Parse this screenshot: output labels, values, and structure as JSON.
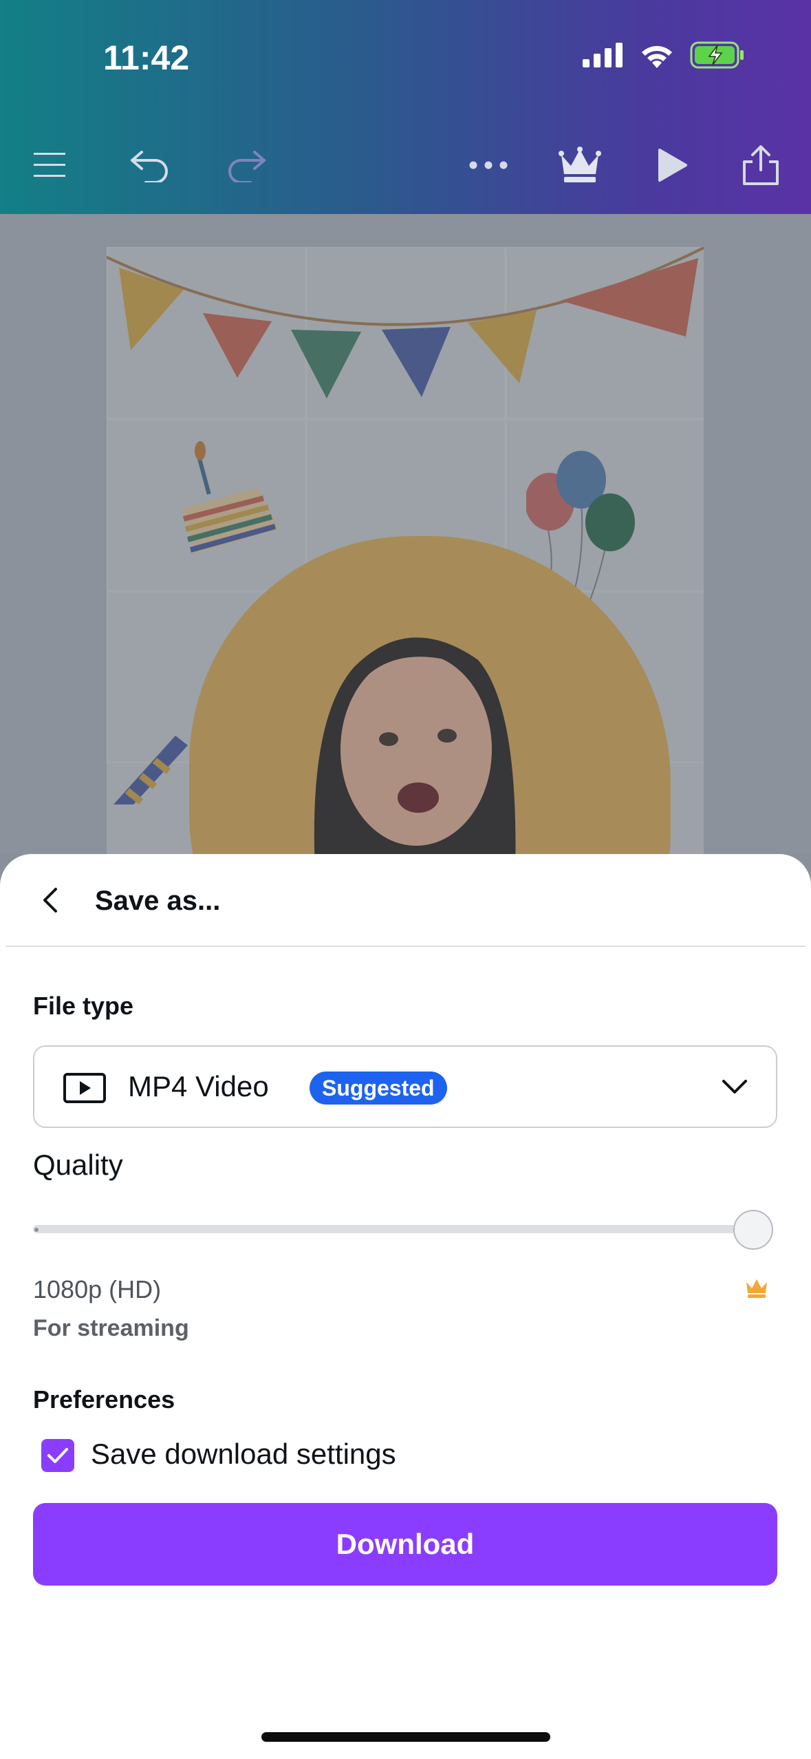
{
  "status_bar": {
    "time": "11:42"
  },
  "toolbar": {
    "icons": [
      "menu-icon",
      "undo-icon",
      "redo-icon",
      "more-icon",
      "crown-icon",
      "play-icon",
      "share-icon"
    ]
  },
  "sheet": {
    "title": "Save as...",
    "file_type_label": "File type",
    "file_type_value": "MP4 Video",
    "file_type_badge": "Suggested",
    "quality_label": "Quality",
    "quality_level": 1.0,
    "resolution": "1080p (HD)",
    "resolution_note": "For streaming",
    "preferences_label": "Preferences",
    "save_settings_label": "Save download settings",
    "save_settings_checked": true,
    "download_label": "Download"
  },
  "colors": {
    "accent": "#8b3dff",
    "badge": "#1e63f0",
    "crown": "#f2a933"
  }
}
